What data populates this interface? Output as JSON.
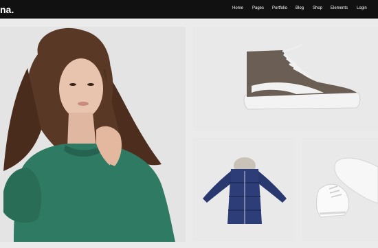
{
  "header": {
    "brand": "na.",
    "nav": [
      {
        "label": "Home"
      },
      {
        "label": "Pages"
      },
      {
        "label": "Portfolio"
      },
      {
        "label": "Blog"
      },
      {
        "label": "Shop"
      },
      {
        "label": "Elements"
      },
      {
        "label": "Login"
      }
    ]
  },
  "products": [
    {
      "name": "woman-green-sweater"
    },
    {
      "name": "high-top-sneaker"
    },
    {
      "name": "navy-puffer-jacket"
    },
    {
      "name": "white-sneakers"
    }
  ],
  "colors": {
    "topbar": "#111111",
    "background": "#ebebeb",
    "nav_text": "#ffffff"
  }
}
